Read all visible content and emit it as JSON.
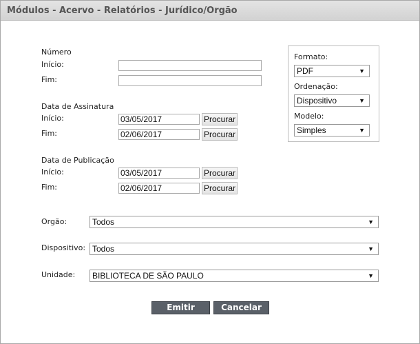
{
  "window": {
    "title": "Módulos - Acervo - Relatórios - Jurídico/Orgão"
  },
  "numero": {
    "section": "Número",
    "inicio_label": "Início:",
    "fim_label": "Fim:",
    "inicio_value": "",
    "fim_value": ""
  },
  "assinatura": {
    "section": "Data de Assinatura",
    "inicio_label": "Início:",
    "fim_label": "Fim:",
    "inicio_value": "03/05/2017",
    "fim_value": "02/06/2017",
    "procurar_label": "Procurar"
  },
  "publicacao": {
    "section": "Data de Publicação",
    "inicio_label": "Início:",
    "fim_label": "Fim:",
    "inicio_value": "03/05/2017",
    "fim_value": "02/06/2017",
    "procurar_label": "Procurar"
  },
  "options": {
    "formato_label": "Formato:",
    "formato_value": "PDF",
    "ordenacao_label": "Ordenação:",
    "ordenacao_value": "Dispositivo",
    "modelo_label": "Modelo:",
    "modelo_value": "Simples"
  },
  "filters": {
    "orgao_label": "Orgão:",
    "orgao_value": "Todos",
    "dispositivo_label": "Dispositivo:",
    "dispositivo_value": "Todos",
    "unidade_label": "Unidade:",
    "unidade_value": "BIBLIOTECA DE SÃO PAULO"
  },
  "actions": {
    "emitir_label": "Emitir",
    "cancelar_label": "Cancelar"
  },
  "icons": {
    "dropdown": "chevron-down-icon"
  }
}
